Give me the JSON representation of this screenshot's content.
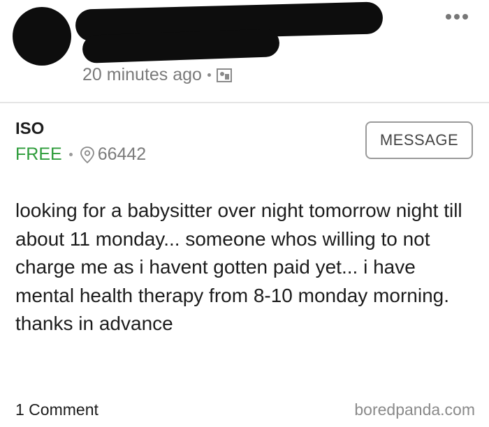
{
  "post": {
    "timestamp": "20 minutes ago",
    "title": "ISO",
    "price": "FREE",
    "zip": "66442",
    "message_button": "MESSAGE",
    "body_lines": [
      "looking for a babysitter over night tomorrow night till about 11 monday... someone whos willing to not charge me as i havent gotten paid yet... i have mental health therapy from 8-10 monday morning.",
      "thanks in advance"
    ],
    "comments": "1 Comment"
  },
  "watermark": "boredpanda.com",
  "colors": {
    "price": "#2d9c3a",
    "muted": "#7a7a7a"
  },
  "icons": {
    "menu": "more-dots-icon",
    "audience": "audience-icon",
    "location": "location-pin-icon"
  }
}
